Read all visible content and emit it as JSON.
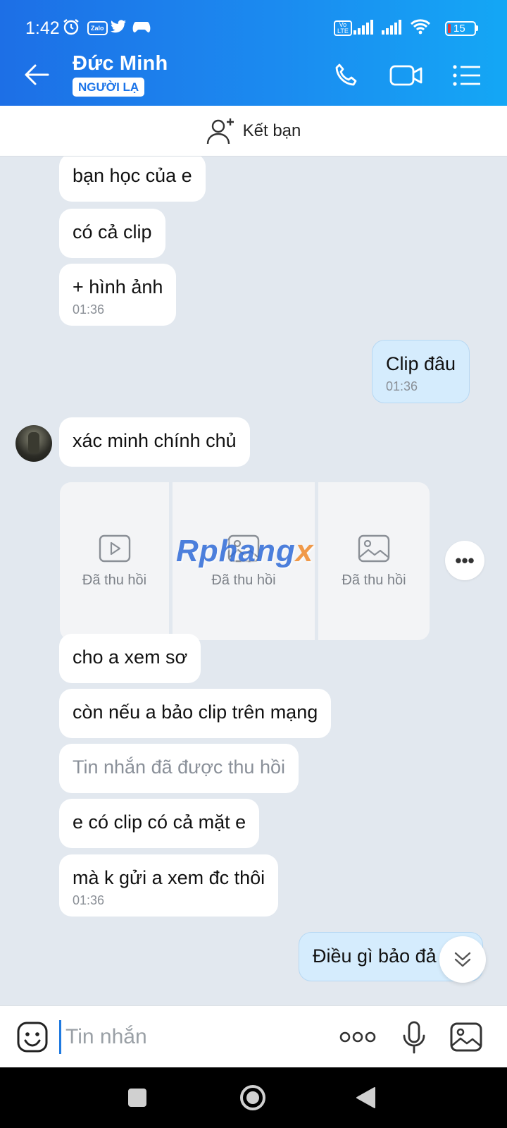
{
  "status_bar": {
    "time": "1:42",
    "zalo_label": "Zalo",
    "volte_label": "Vo\nLTE",
    "battery_level": "15"
  },
  "header": {
    "contact_name": "Đức Minh",
    "stranger_badge": "NGƯỜI LẠ",
    "accent_color": "#1b8bf0"
  },
  "add_friend": {
    "label": "Kết bạn"
  },
  "messages": [
    {
      "dir": "in",
      "text": "bạn học của e"
    },
    {
      "dir": "in",
      "text": "có cả clip"
    },
    {
      "dir": "in",
      "text": "+ hình ảnh",
      "time": "01:36"
    },
    {
      "dir": "out",
      "text": "Clip đâu",
      "time": "01:36"
    },
    {
      "dir": "in",
      "text": "xác minh chính chủ"
    },
    {
      "dir": "in",
      "text": "cho a xem sơ"
    },
    {
      "dir": "in",
      "text": "còn nếu a bảo clip trên mạng"
    },
    {
      "dir": "in",
      "text": "Tin nhắn đã được thu hồi",
      "recalled": true
    },
    {
      "dir": "in",
      "text": "e có clip có cả mặt e"
    },
    {
      "dir": "in",
      "text": "mà k gửi a xem đc thôi",
      "time": "01:36"
    },
    {
      "dir": "out",
      "text": "Điều gì bảo đả"
    }
  ],
  "media": [
    {
      "icon": "video-icon",
      "label": "Đã thu hồi"
    },
    {
      "icon": "image-icon",
      "label": "Đã thu hồi"
    },
    {
      "icon": "image-icon",
      "label": "Đã thu hồi"
    }
  ],
  "watermark": {
    "main": "Rphang",
    "suffix": "x"
  },
  "more_label": "•••",
  "input": {
    "placeholder": "Tin nhắn",
    "value": ""
  }
}
